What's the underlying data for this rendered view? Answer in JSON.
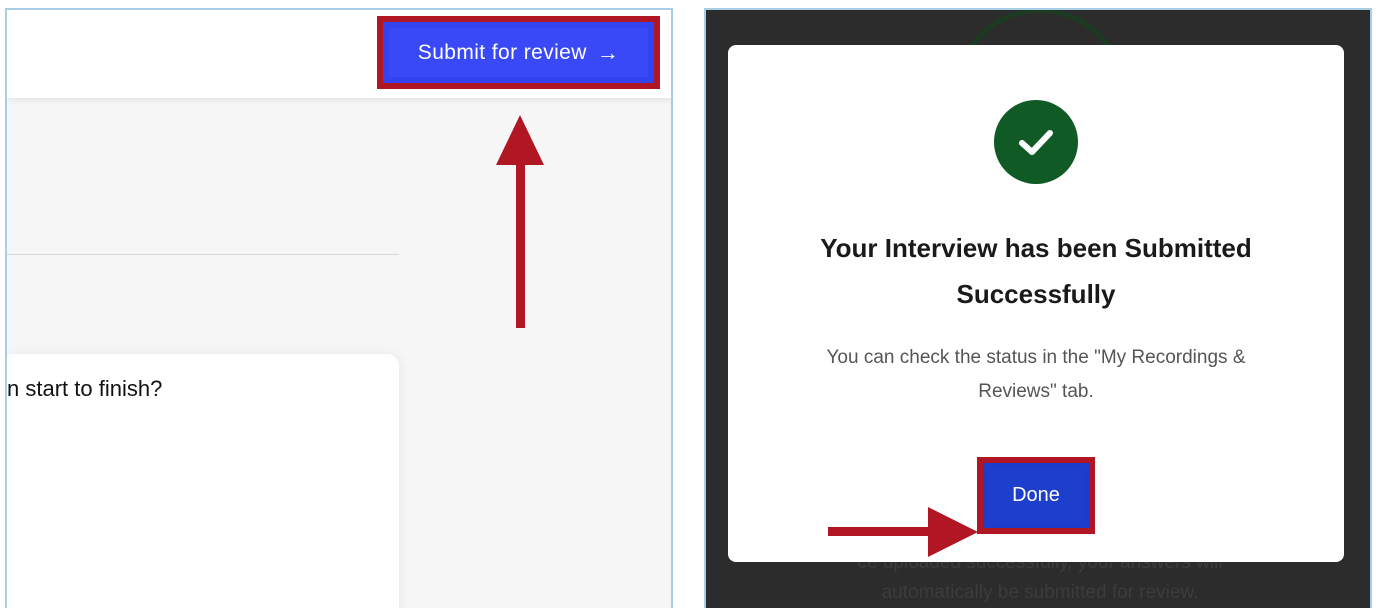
{
  "left": {
    "submit_button": {
      "label": "Submit for review",
      "icon": "arrow-right-icon",
      "arrow_glyph": "→"
    },
    "question_card": {
      "text": "n start to finish?"
    }
  },
  "right": {
    "modal": {
      "icon": "check-circle-icon",
      "title_line1": "Your Interview has been Submitted",
      "title_line2": "Successfully",
      "body_line1": "You can check the status in the \"My Recordings &",
      "body_line2": "Reviews\" tab.",
      "done_label": "Done"
    },
    "background": {
      "line1": "ce uploaded successfully, your answers will",
      "line2": "automatically be submitted for review."
    }
  },
  "colors": {
    "highlight": "#b01623",
    "submit_button_bg": "#3a49f8",
    "done_button_bg": "#1e3ecc",
    "success_green": "#0f5a25",
    "overlay_bg": "#2c2c2c"
  }
}
